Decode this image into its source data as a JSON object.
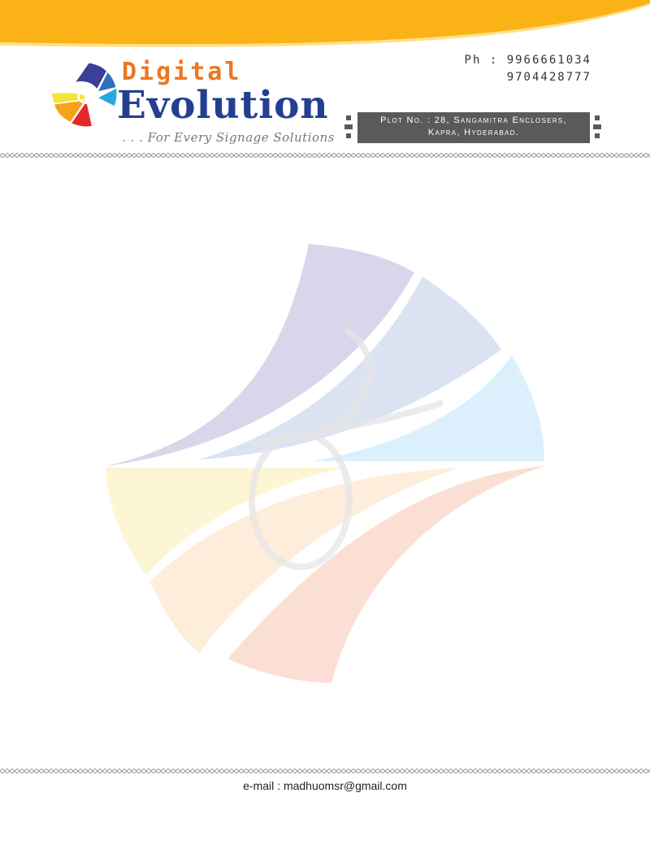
{
  "brand": {
    "line1": "Digital",
    "line2": "Evolution",
    "tagline": ". . . For Every Signage Solutions"
  },
  "contact": {
    "phone_label": "Ph :",
    "phone1": "9966661034",
    "phone2": "9704428777",
    "address_line1": "Plot No. : 28, Sangamitra Enclosers,",
    "address_line2": "Kapra, Hyderabad.",
    "email_label": "e-mail :",
    "email": "madhuomsr@gmail.com"
  },
  "colors": {
    "orange": "#fbb216",
    "brand_orange": "#ec7622",
    "brand_blue": "#243f8f",
    "address_bg": "#5a5a5c"
  },
  "icons": [
    "brand-logo-icon",
    "watermark-logo-icon"
  ]
}
